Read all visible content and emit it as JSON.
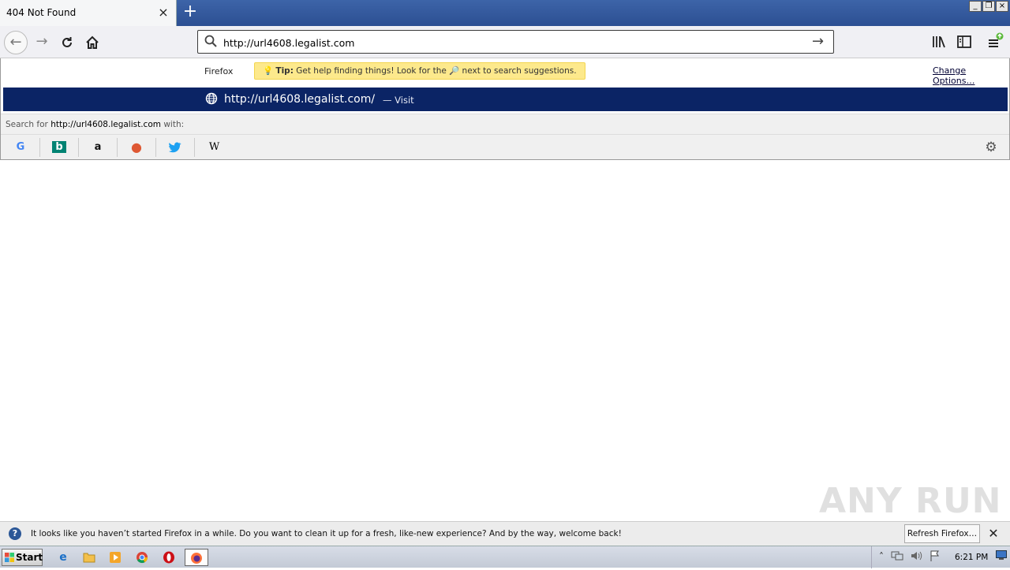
{
  "browser": {
    "tab": {
      "title": "404 Not Found",
      "close_glyph": "×"
    },
    "new_tab_glyph": "+",
    "window_buttons": [
      "_",
      "❐",
      "×"
    ]
  },
  "navbar": {
    "url": "http://url4608.legalist.com",
    "icons": [
      "back-arrow-icon",
      "forward-arrow-icon",
      "reload-icon",
      "home-icon",
      "search-icon",
      "go-arrow-icon",
      "library-icon",
      "sidebar-icon",
      "menu-icon"
    ]
  },
  "dropdown": {
    "firefox_label": "Firefox",
    "tip_label": "Tip:",
    "tip_text": "Get help finding things! Look for the 🔎 next to search suggestions.",
    "change_options": "Change Options…",
    "result": {
      "url": "http://url4608.legalist.com/",
      "action": "— Visit"
    },
    "search_for_prefix": "Search for",
    "search_for_query": "http://url4608.legalist.com",
    "search_for_suffix": "with:",
    "engines": [
      {
        "name": "google-icon",
        "glyph": "G",
        "color": "#4285f4"
      },
      {
        "name": "bing-icon",
        "glyph": "b",
        "color": "#008373"
      },
      {
        "name": "amazon-icon",
        "glyph": "a",
        "color": "#111111"
      },
      {
        "name": "duckduckgo-icon",
        "glyph": "●",
        "color": "#de5833"
      },
      {
        "name": "twitter-icon",
        "glyph": "🐦",
        "color": "#1da1f2"
      },
      {
        "name": "wikipedia-icon",
        "glyph": "W",
        "color": "#000000"
      }
    ]
  },
  "watermark": "ANY RUN",
  "notification": {
    "text": "It looks like you haven’t started Firefox in a while. Do you want to clean it up for a fresh, like-new experience? And by the way, welcome back!",
    "button": "Refresh Firefox…"
  },
  "taskbar": {
    "start": "Start",
    "apps": [
      "internet-explorer-icon",
      "file-explorer-icon",
      "media-player-icon",
      "chrome-icon",
      "opera-icon",
      "firefox-icon"
    ],
    "clock": "6:21 PM"
  },
  "colors": {
    "accent": "#0b2465",
    "tab_strip": "#2c4f92",
    "tip_bg": "#fde98c"
  }
}
